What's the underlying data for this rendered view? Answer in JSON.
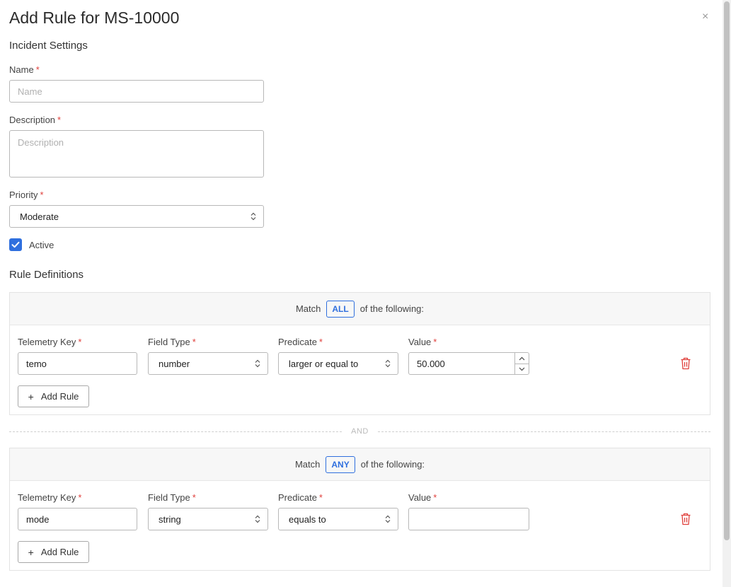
{
  "modal": {
    "title": "Add Rule for MS-10000",
    "close_glyph": "×"
  },
  "incident": {
    "section_title": "Incident Settings",
    "required_marker": "*",
    "name": {
      "label": "Name",
      "placeholder": "Name",
      "value": ""
    },
    "description": {
      "label": "Description",
      "placeholder": "Description",
      "value": ""
    },
    "priority": {
      "label": "Priority",
      "value": "Moderate"
    },
    "active": {
      "label": "Active",
      "checked": true
    }
  },
  "rules": {
    "section_title": "Rule Definitions",
    "columns": {
      "telemetry_key": "Telemetry Key",
      "field_type": "Field Type",
      "predicate": "Predicate",
      "value": "Value"
    },
    "add_rule_label": "Add Rule",
    "separator_label": "AND",
    "groups": [
      {
        "match_prefix": "Match",
        "match_mode": "ALL",
        "match_suffix": "of the following:",
        "rule": {
          "telemetry_key": "temo",
          "field_type": "number",
          "predicate": "larger or equal to",
          "value": "50.000"
        }
      },
      {
        "match_prefix": "Match",
        "match_mode": "ANY",
        "match_suffix": "of the following:",
        "rule": {
          "telemetry_key": "mode",
          "field_type": "string",
          "predicate": "equals to",
          "value": ""
        }
      }
    ]
  },
  "icons": {
    "close": "close-icon",
    "chevron": "chevron-up-down-icon",
    "check": "check-icon",
    "trash": "trash-icon",
    "plus": "plus-icon",
    "step_up": "chevron-up-icon",
    "step_down": "chevron-down-icon"
  },
  "colors": {
    "accent": "#2f6fde",
    "required": "#e0403c",
    "delete": "#e0403c"
  }
}
